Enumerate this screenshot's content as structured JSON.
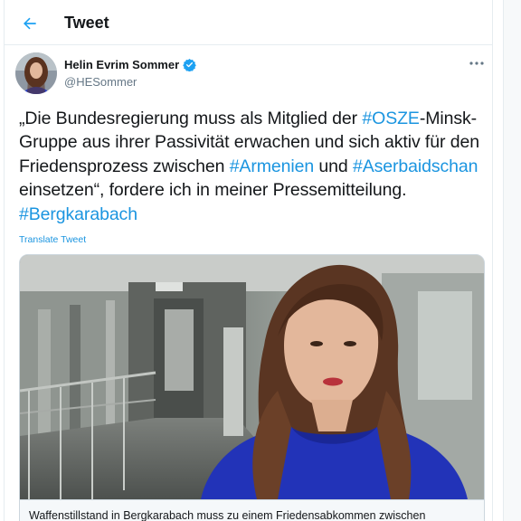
{
  "header": {
    "title": "Tweet"
  },
  "author": {
    "name": "Helin Evrim Sommer",
    "handle": "@HESommer"
  },
  "tweet": {
    "segments": [
      {
        "text": "„Die Bundesregierung muss als Mitglied der ",
        "tag": false
      },
      {
        "text": "#OSZE",
        "tag": true
      },
      {
        "text": "-Minsk-Gruppe aus ihrer Passivität erwachen und sich aktiv für den Friedensprozess zwischen ",
        "tag": false
      },
      {
        "text": "#Armenien",
        "tag": true
      },
      {
        "text": " und ",
        "tag": false
      },
      {
        "text": "#Aserbaidschan",
        "tag": true
      },
      {
        "text": " einsetzen“, fordere ich in meiner Pressemitteilung. ",
        "tag": false
      },
      {
        "text": "#Bergkarabach",
        "tag": true
      }
    ],
    "translate_label": "Translate Tweet"
  },
  "card": {
    "caption": "Waffenstillstand in Bergkarabach muss zu einem Friedensabkommen zwischen"
  },
  "colors": {
    "link": "#1b95e0",
    "verified": "#1da1f2",
    "text": "#14171a",
    "secondary": "#657786"
  },
  "icons": {
    "back": "arrow-left-icon",
    "verified": "verified-badge-icon",
    "more": "more-horizontal-icon"
  }
}
